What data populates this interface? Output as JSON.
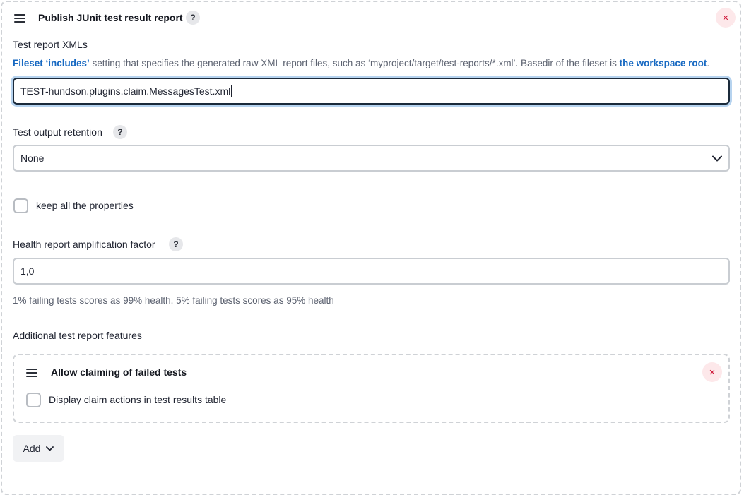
{
  "section": {
    "title": "Publish JUnit test result report",
    "help": "?",
    "close": "×"
  },
  "test_report_xmls": {
    "label": "Test report XMLs",
    "desc_link1": "Fileset ‘includes’",
    "desc_mid": " setting that specifies the generated raw XML report files, such as ‘myproject/target/test-reports/*.xml’. Basedir of the fileset is ",
    "desc_link2": "the workspace root",
    "desc_end": ".",
    "value": "TEST-hundson.plugins.claim.MessagesTest.xml"
  },
  "retention": {
    "label": "Test output retention",
    "help": "?",
    "selected": "None"
  },
  "keep_properties": {
    "label": "keep all the properties",
    "checked": false
  },
  "health": {
    "label": "Health report amplification factor",
    "help": "?",
    "value": "1,0",
    "hint": "1% failing tests scores as 99% health. 5% failing tests scores as 95% health"
  },
  "additional": {
    "label": "Additional test report features",
    "feature": {
      "title": "Allow claiming of failed tests",
      "close": "×",
      "checkbox_label": "Display claim actions in test results table",
      "checked": false
    }
  },
  "add_button": {
    "label": "Add"
  }
}
